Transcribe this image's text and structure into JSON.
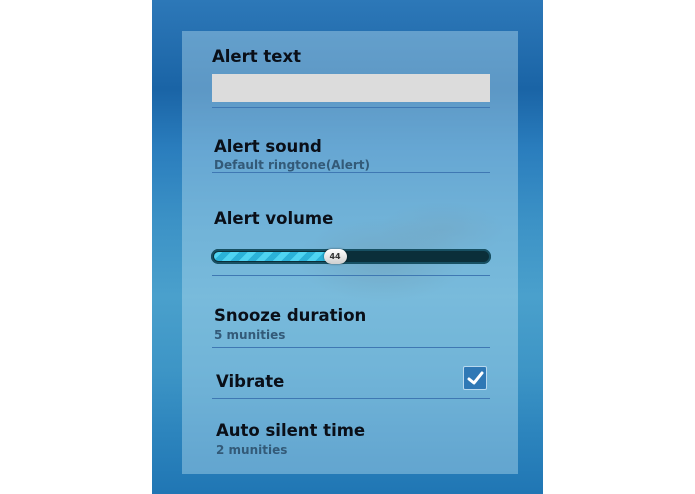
{
  "alert_text": {
    "label": "Alert text",
    "value": ""
  },
  "alert_sound": {
    "label": "Alert sound",
    "value": "Default ringtone(Alert)"
  },
  "alert_volume": {
    "label": "Alert volume",
    "value": 44,
    "min": 0,
    "max": 100
  },
  "snooze_duration": {
    "label": "Snooze duration",
    "value": "5 munities"
  },
  "vibrate": {
    "label": "Vibrate",
    "checked": true
  },
  "auto_silent_time": {
    "label": "Auto silent time",
    "value": "2 munities"
  },
  "colors": {
    "accent": "#2bb2d8",
    "divider": "#3f78b3",
    "checkbox": "#2f78b5"
  }
}
